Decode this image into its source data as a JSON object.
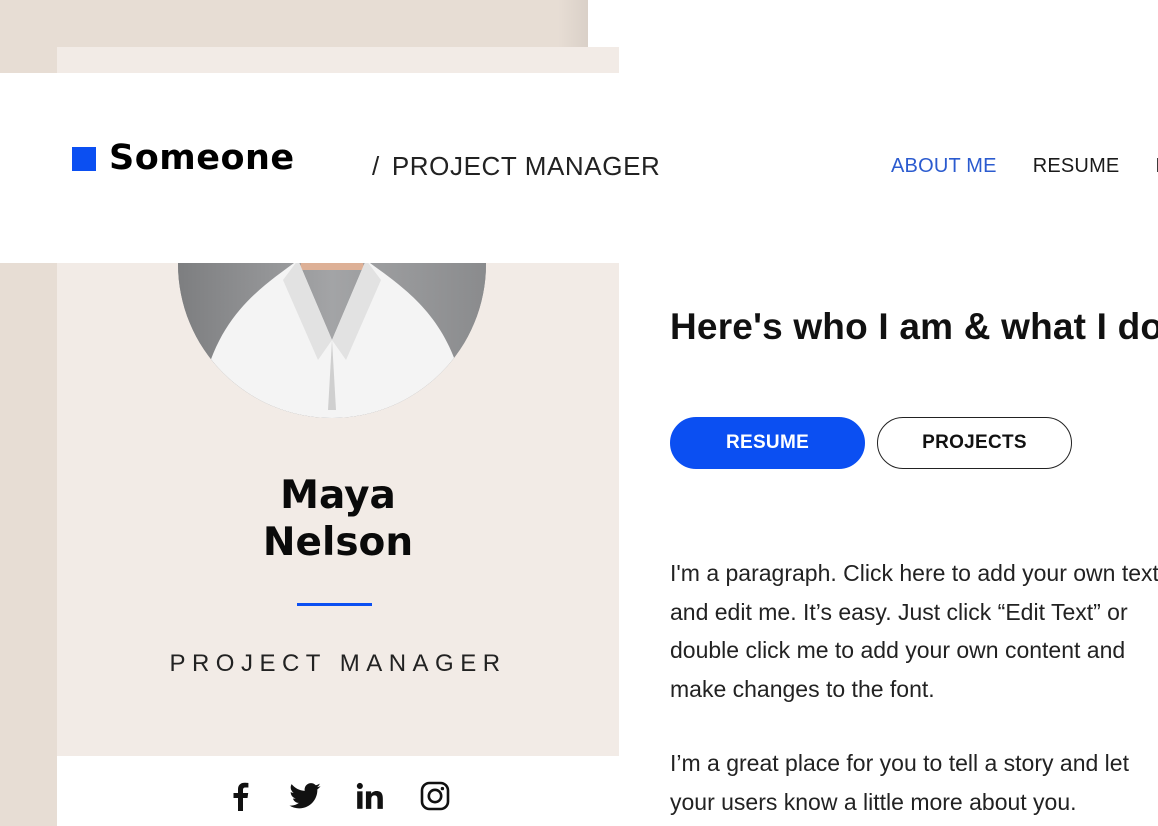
{
  "brand": {
    "name": "Someone",
    "accent_color": "#0b4ff2"
  },
  "header": {
    "role_slash": "/",
    "role": "PROJECT MANAGER",
    "nav": [
      {
        "label": "ABOUT ME",
        "active": true
      },
      {
        "label": "RESUME",
        "active": false
      },
      {
        "label": "F",
        "active": false
      }
    ]
  },
  "profile": {
    "photo_icon": "portrait-photo",
    "first_name": "Maya",
    "last_name": "Nelson",
    "role": "PROJECT MANAGER",
    "socials": [
      "facebook-icon",
      "twitter-icon",
      "linkedin-icon",
      "instagram-icon"
    ]
  },
  "main": {
    "heading": "Here's who I am & what I do",
    "buttons": {
      "primary": "RESUME",
      "secondary": "PROJECTS"
    },
    "paragraph1": [
      "I'm a paragraph. Click here to add your own text",
      "and edit me. It’s easy. Just click “Edit Text” or",
      "double click me to add your own content and",
      "make changes to the font."
    ],
    "paragraph2": [
      "I’m a great place for you to tell a story and let",
      "your users know a little more about you."
    ]
  }
}
